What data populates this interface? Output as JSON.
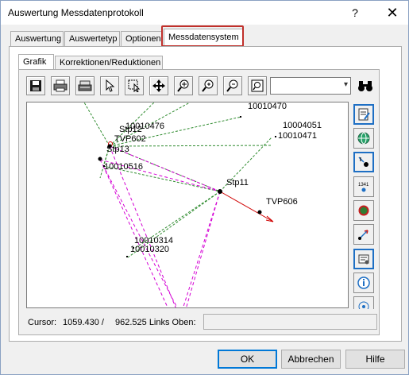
{
  "window": {
    "title": "Auswertung Messdatenprotokoll",
    "help": "?",
    "close": "✕"
  },
  "tabs": [
    "Auswertung",
    "Auswertetyp",
    "Optionen",
    "Messdatensystem"
  ],
  "active_tab": "Messdatensystem",
  "inner_tabs": [
    "Grafik",
    "Korrektionen/Reduktionen"
  ],
  "toolbar": {
    "buttons": [
      "save-icon",
      "print-icon",
      "printer-setup-icon",
      "pointer-icon",
      "select-area-icon",
      "pan-icon",
      "zoom-point-icon",
      "zoom-in-icon",
      "zoom-out-icon",
      "zoom-extents-icon"
    ],
    "combo_value": "",
    "search": "binoculars-icon"
  },
  "plot": {
    "points": [
      "10010470",
      "10010476",
      "Stp12",
      "TVP602",
      "Stp13",
      "10010516",
      "10004051",
      "10010471",
      "Stp11",
      "TVP606",
      "10010314",
      "10010320"
    ],
    "colors": {
      "green_lines": "#2e8b2e",
      "magenta_lines": "#d400d4",
      "red_vector": "#d00000"
    }
  },
  "side_tools": [
    "properties-icon",
    "globe-icon",
    "point-add-icon",
    "numbering-icon",
    "area-icon",
    "vector-icon",
    "settings-icon",
    "info-icon",
    "target-icon"
  ],
  "status": {
    "cursor_label": "Cursor:",
    "cursor_x": "1059.430 /",
    "cursor_y": "962.525 Links Oben:",
    "field_value": ""
  },
  "buttons": {
    "ok": "OK",
    "cancel": "Abbrechen",
    "help": "Hilfe"
  }
}
